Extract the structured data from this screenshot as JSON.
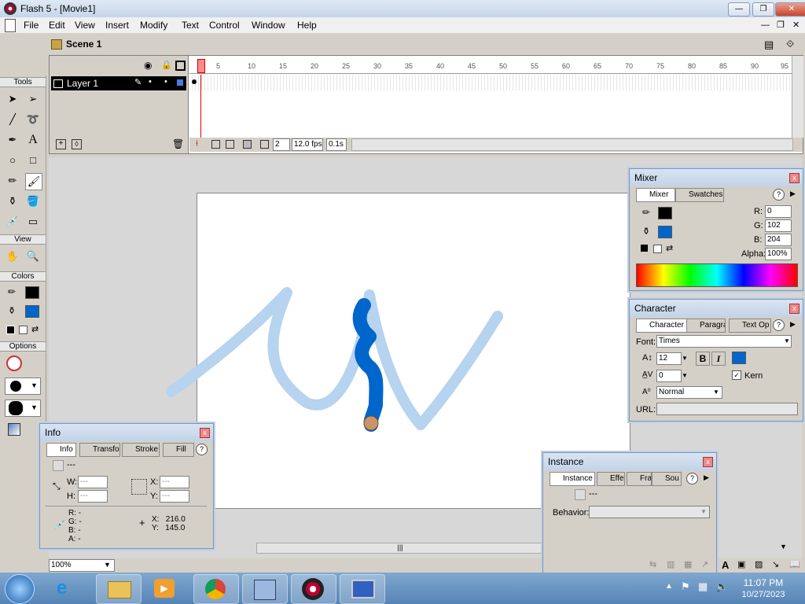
{
  "window": {
    "title": "Flash 5 - [Movie1]"
  },
  "menu": [
    "File",
    "Edit",
    "View",
    "Insert",
    "Modify",
    "Text",
    "Control",
    "Window",
    "Help"
  ],
  "scene": {
    "label": "Scene 1"
  },
  "timeline": {
    "layer_name": "Layer 1",
    "ruler_ticks": [
      "5",
      "10",
      "15",
      "20",
      "25",
      "30",
      "35",
      "40",
      "45",
      "50",
      "55",
      "60",
      "65",
      "70",
      "75",
      "80",
      "85",
      "90",
      "95"
    ],
    "current_frame": "2",
    "fps": "12.0 fps",
    "time": "0.1s"
  },
  "tools": {
    "title": "Tools",
    "view_label": "View",
    "colors_label": "Colors",
    "options_label": "Options",
    "stroke_color": "#000000",
    "fill_color": "#0066cc"
  },
  "mixer": {
    "title": "Mixer",
    "tab_mixer": "Mixer",
    "tab_swatches": "Swatches",
    "r_label": "R:",
    "r": "0",
    "g_label": "G:",
    "g": "102",
    "b_label": "B:",
    "b": "204",
    "alpha_label": "Alpha:",
    "alpha": "100%",
    "stroke_color": "#000000",
    "fill_color": "#0066cc"
  },
  "character": {
    "title": "Character",
    "tab_character": "Character",
    "tab_paragraph": "Paragra",
    "tab_textopt": "Text Op",
    "font_label": "Font:",
    "font": "Times",
    "size": "12",
    "tracking": "0",
    "kern_label": "Kern",
    "baseline": "Normal",
    "url_label": "URL:",
    "bold": "B",
    "italic": "I",
    "text_color": "#0066cc"
  },
  "info": {
    "title": "Info",
    "tab_info": "Info",
    "tab_transform": "Transfo",
    "tab_stroke": "Stroke",
    "tab_fill": "Fill",
    "dash": "---",
    "w_label": "W:",
    "w": "---",
    "h_label": "H:",
    "h": "---",
    "x_label": "X:",
    "x": "---",
    "y_label": "Y:",
    "y": "---",
    "r_line": "R: -",
    "g_line": "G: -",
    "b_line": "B: -",
    "a_line": "A: -",
    "cursor_x": "X:   216.0",
    "cursor_y": "Y:   145.0"
  },
  "instance": {
    "title": "Instance",
    "tab_instance": "Instance",
    "tab_effect": "Effe",
    "tab_frame": "Fra",
    "tab_sound": "Sou",
    "dash": "---",
    "behavior_label": "Behavior:"
  },
  "zoom": "100%",
  "taskbar": {
    "time": "11:07 PM",
    "date": "10/27/2023"
  },
  "drawing": {
    "light_stroke": "#b6d3ef",
    "dark_stroke": "#0066cc"
  }
}
